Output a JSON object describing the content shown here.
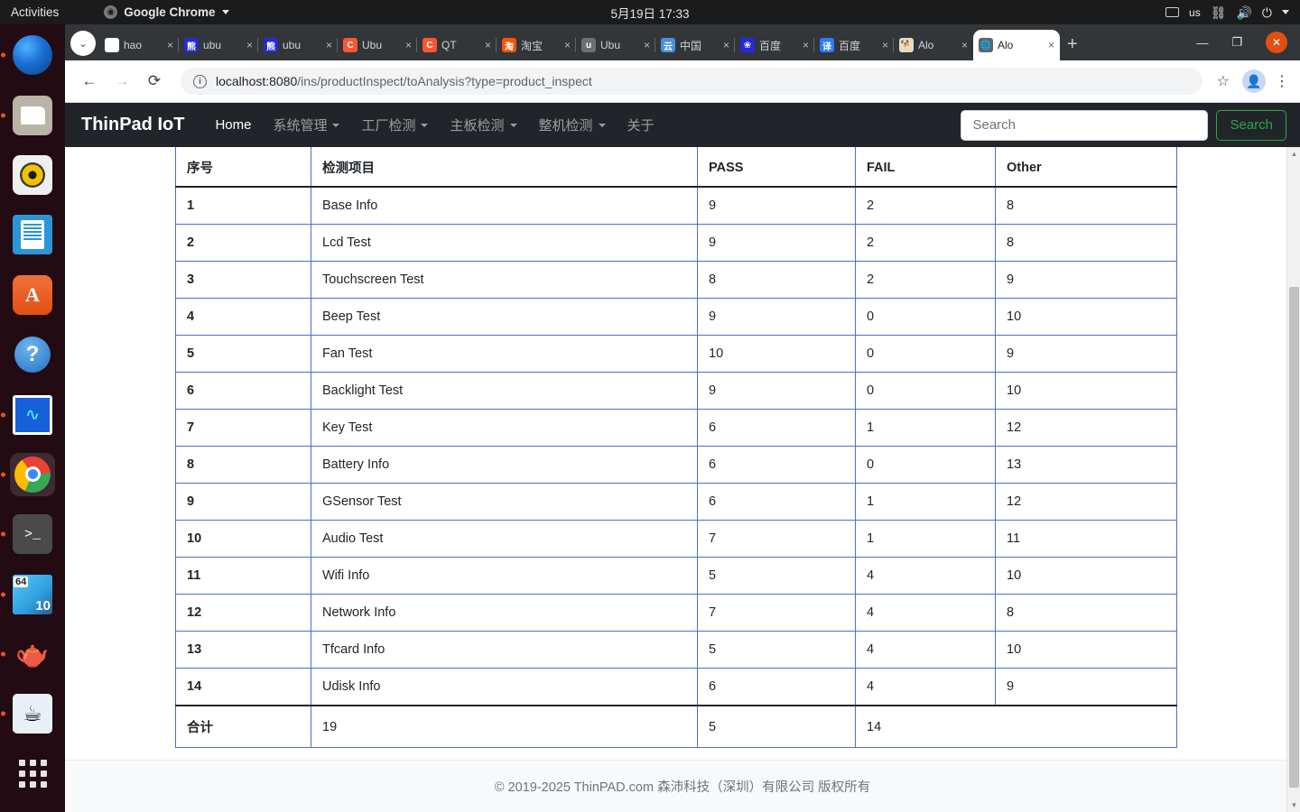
{
  "desktop": {
    "activities_label": "Activities",
    "app_menu_label": "Google Chrome",
    "clock": "5月19日  17:33",
    "keyboard_layout": "us",
    "dock_items": [
      {
        "name": "thunderbird",
        "label": "Thunderbird Mail"
      },
      {
        "name": "files",
        "label": "Files"
      },
      {
        "name": "rhythmbox",
        "label": "Rhythmbox"
      },
      {
        "name": "libreoffice-writer",
        "label": "LibreOffice Writer"
      },
      {
        "name": "ubuntu-software",
        "label": "Ubuntu Software",
        "glyph": "A"
      },
      {
        "name": "help",
        "label": "Help",
        "glyph": "?"
      },
      {
        "name": "system-monitor",
        "label": "System Monitor",
        "glyph": "∿"
      },
      {
        "name": "google-chrome",
        "label": "Google Chrome"
      },
      {
        "name": "terminal",
        "label": "Terminal",
        "glyph": ">_"
      },
      {
        "name": "map-64-10",
        "label": "Map",
        "badge_top": "64",
        "badge_bottom": "10"
      },
      {
        "name": "teapot",
        "label": "Teapot",
        "glyph": "🫖"
      },
      {
        "name": "java",
        "label": "Java",
        "glyph": "☕"
      },
      {
        "name": "show-apps",
        "label": "Show Applications"
      }
    ]
  },
  "browser": {
    "tabs": [
      {
        "title": "hao",
        "favicon": "hao-icon",
        "favicon_text": "✓",
        "active": false
      },
      {
        "title": "ubu",
        "favicon": "baidu-icon",
        "favicon_text": "熊",
        "active": false
      },
      {
        "title": "ubu",
        "favicon": "baidu-icon",
        "favicon_text": "熊",
        "active": false
      },
      {
        "title": "Ubu",
        "favicon": "csdn-icon",
        "favicon_text": "C",
        "active": false
      },
      {
        "title": "QT",
        "favicon": "csdn-icon",
        "favicon_text": "C",
        "active": false
      },
      {
        "title": "淘宝",
        "favicon": "taobao-icon",
        "favicon_text": "淘",
        "active": false
      },
      {
        "title": "Ubu",
        "favicon": "gray-icon",
        "favicon_text": "u",
        "active": false
      },
      {
        "title": "中国",
        "favicon": "cloud-icon",
        "favicon_text": "云",
        "active": false
      },
      {
        "title": "百度",
        "favicon": "baidu-share-icon",
        "favicon_text": "❀",
        "active": false
      },
      {
        "title": "百度",
        "favicon": "fanyi-icon",
        "favicon_text": "译",
        "active": false
      },
      {
        "title": "Alo",
        "favicon": "dog-icon",
        "favicon_text": "🐕",
        "active": false
      },
      {
        "title": "Alo",
        "favicon": "globe-icon",
        "favicon_text": "🌐",
        "active": true
      }
    ],
    "new_tab_label": "+",
    "tab_search_label": "⌄",
    "close_tab_label": "×",
    "window_controls": {
      "minimize": "—",
      "maximize": "❐",
      "close": "✕"
    },
    "toolbar": {
      "back_label": "←",
      "forward_label": "→",
      "reload_label": "⟳",
      "site_info_label": "ⓘ",
      "url_host": "localhost:8080",
      "url_path": "/ins/productInspect/toAnalysis?type=product_inspect",
      "bookmark_label": "☆",
      "profile_label": "👤",
      "menu_label": "⋮"
    }
  },
  "app": {
    "brand": "ThinPad IoT",
    "nav_items": [
      {
        "label": "Home",
        "dropdown": false,
        "active": true
      },
      {
        "label": "系统管理",
        "dropdown": true,
        "active": false
      },
      {
        "label": "工厂检测",
        "dropdown": true,
        "active": false
      },
      {
        "label": "主板检测",
        "dropdown": true,
        "active": false
      },
      {
        "label": "整机检测",
        "dropdown": true,
        "active": false
      },
      {
        "label": "关于",
        "dropdown": false,
        "active": false
      }
    ],
    "search": {
      "placeholder": "Search",
      "value": "",
      "button_label": "Search"
    },
    "footer_text": "© 2019-2025 ThinPAD.com 森沛科技（深圳）有限公司 版权所有",
    "colors": {
      "navbar_bg": "#212529",
      "search_button": "#28a745",
      "table_border": "#4a6fd4"
    }
  },
  "table": {
    "columns": [
      "序号",
      "检测项目",
      "PASS",
      "FAIL",
      "Other"
    ],
    "rows": [
      {
        "no": "1",
        "item": "Base Info",
        "pass": "9",
        "fail": "2",
        "other": "8"
      },
      {
        "no": "2",
        "item": "Lcd Test",
        "pass": "9",
        "fail": "2",
        "other": "8"
      },
      {
        "no": "3",
        "item": "Touchscreen Test",
        "pass": "8",
        "fail": "2",
        "other": "9"
      },
      {
        "no": "4",
        "item": "Beep Test",
        "pass": "9",
        "fail": "0",
        "other": "10"
      },
      {
        "no": "5",
        "item": "Fan Test",
        "pass": "10",
        "fail": "0",
        "other": "9"
      },
      {
        "no": "6",
        "item": "Backlight Test",
        "pass": "9",
        "fail": "0",
        "other": "10"
      },
      {
        "no": "7",
        "item": "Key Test",
        "pass": "6",
        "fail": "1",
        "other": "12"
      },
      {
        "no": "8",
        "item": "Battery Info",
        "pass": "6",
        "fail": "0",
        "other": "13"
      },
      {
        "no": "9",
        "item": "GSensor Test",
        "pass": "6",
        "fail": "1",
        "other": "12"
      },
      {
        "no": "10",
        "item": "Audio Test",
        "pass": "7",
        "fail": "1",
        "other": "11"
      },
      {
        "no": "11",
        "item": "Wifi Info",
        "pass": "5",
        "fail": "4",
        "other": "10"
      },
      {
        "no": "12",
        "item": "Network Info",
        "pass": "7",
        "fail": "4",
        "other": "8"
      },
      {
        "no": "13",
        "item": "Tfcard Info",
        "pass": "5",
        "fail": "4",
        "other": "10"
      },
      {
        "no": "14",
        "item": "Udisk Info",
        "pass": "6",
        "fail": "4",
        "other": "9"
      }
    ],
    "total": {
      "label": "合计",
      "total_count": "19",
      "pass": "5",
      "fail": "14"
    }
  }
}
